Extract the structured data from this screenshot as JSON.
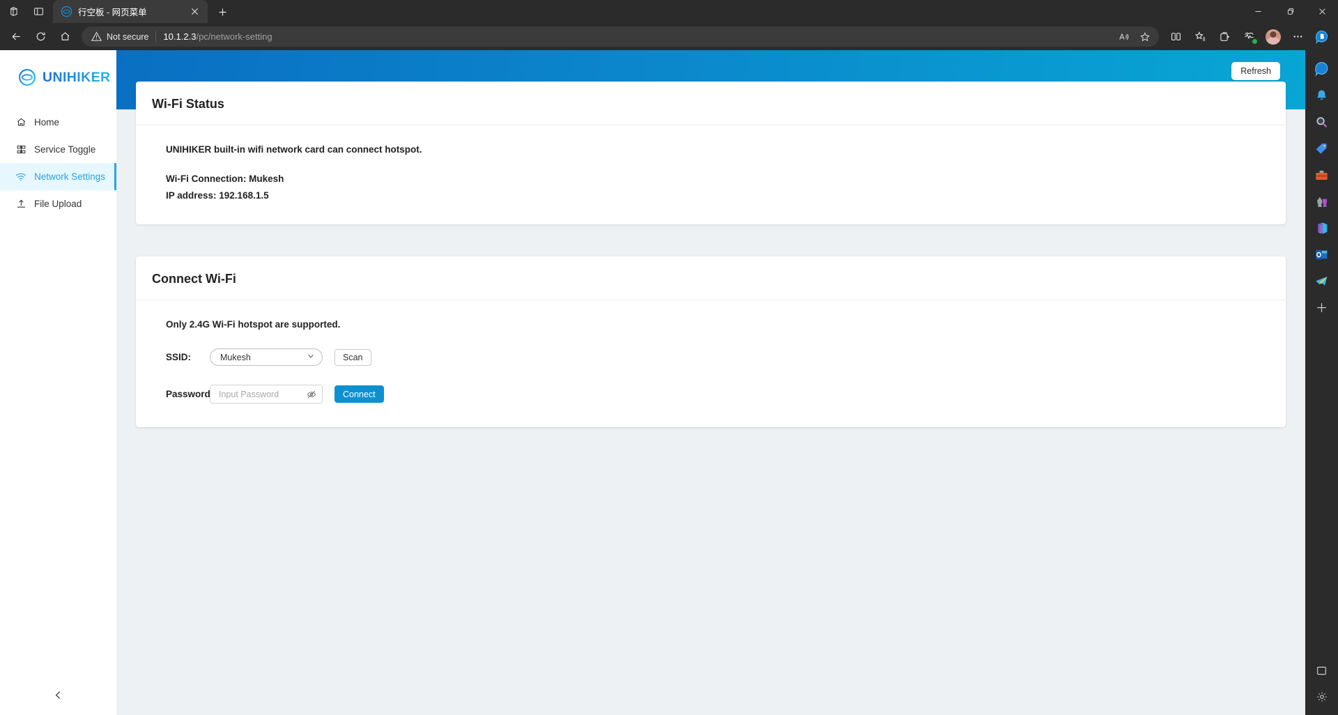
{
  "browser": {
    "tab": {
      "title": "行空板 - 网页菜单",
      "favicon": "unihiker-favicon"
    },
    "new_tab_label": "+",
    "window_controls": {
      "minimize": "minimize-icon",
      "maximize": "restore-icon",
      "close": "close-icon"
    },
    "address": {
      "security_label": "Not secure",
      "host": "10.1.2.3",
      "path": "/pc/network-setting",
      "full_url": "10.1.2.3/pc/network-setting"
    },
    "toolbar_icons": [
      "read-aloud-icon",
      "favorite-star-icon",
      "split-screen-icon",
      "favorites-icon",
      "collections-icon",
      "browser-essentials-icon",
      "profile-avatar",
      "settings-more-icon",
      "copilot-icon"
    ],
    "rail_icons": [
      "notifications-bell-icon",
      "search-icon",
      "shopping-tag-icon",
      "tools-toolbox-icon",
      "games-icon",
      "copilot-icon",
      "outlook-icon",
      "telegram-icon",
      "add-app-icon",
      "screenshot-icon",
      "settings-gear-icon"
    ]
  },
  "sidebar": {
    "logo_text": "UNIHIKER",
    "items": [
      {
        "label": "Home",
        "icon": "home-icon",
        "active": false
      },
      {
        "label": "Service Toggle",
        "icon": "grid-icon",
        "active": false
      },
      {
        "label": "Network Settings",
        "icon": "wifi-icon",
        "active": true
      },
      {
        "label": "File Upload",
        "icon": "upload-icon",
        "active": false
      }
    ],
    "collapse_label": "collapse-icon"
  },
  "header": {
    "refresh_label": "Refresh",
    "accent_start": "#0a6fc2",
    "accent_end": "#08a6d4"
  },
  "wifi_status": {
    "title": "Wi-Fi Status",
    "description": "UNIHIKER built-in wifi network card can connect hotspot.",
    "connection_line": "Wi-Fi Connection: Mukesh",
    "ip_line": "IP address: 192.168.1.5"
  },
  "connect_wifi": {
    "title": "Connect Wi-Fi",
    "note": "Only 2.4G Wi-Fi hotspot are supported.",
    "ssid_label": "SSID:",
    "ssid_value": "Mukesh",
    "scan_label": "Scan",
    "password_label": "Password:",
    "password_placeholder": "Input Password",
    "password_value": "",
    "connect_label": "Connect",
    "connect_color": "#0d90d0"
  }
}
